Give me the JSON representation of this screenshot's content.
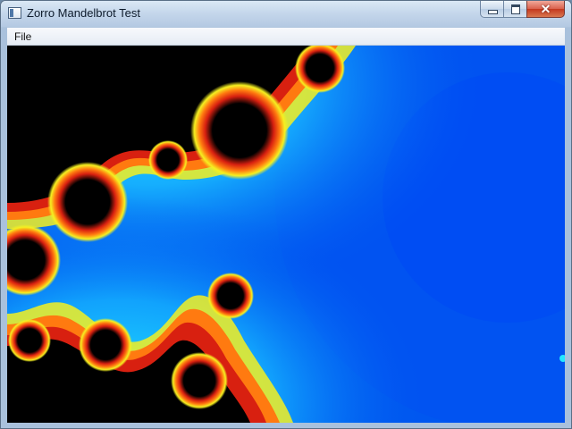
{
  "window": {
    "title": "Zorro Mandelbrot Test",
    "icon": "app-window-icon",
    "controls": {
      "minimize_icon": "minimize-icon",
      "maximize_icon": "maximize-icon",
      "close_icon": "close-icon",
      "close_glyph": "✕"
    }
  },
  "menubar": {
    "items": [
      "File"
    ]
  },
  "canvas": {
    "content": "mandelbrot-fractal",
    "colors": {
      "background_blue": "#0057f0",
      "halo_cyan": "#22e8ff",
      "outer_band_yellow": "#f5f020",
      "inner_band_orange": "#ff7a10",
      "edge_red": "#d82010",
      "set_black": "#000000"
    }
  }
}
